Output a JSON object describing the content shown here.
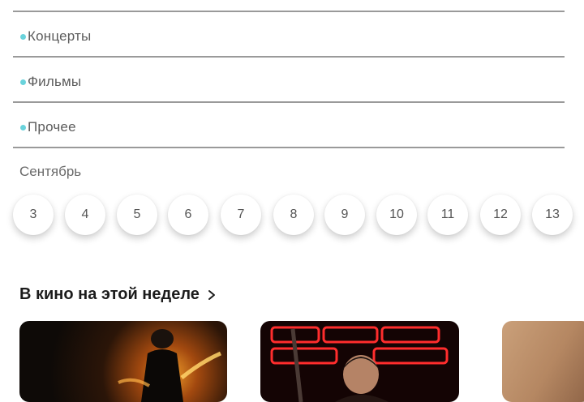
{
  "categories": [
    {
      "label": "Концерты"
    },
    {
      "label": "Фильмы"
    },
    {
      "label": "Прочее"
    }
  ],
  "calendar": {
    "month": "Сентябрь",
    "days": [
      "3",
      "4",
      "5",
      "6",
      "7",
      "8",
      "9",
      "10",
      "11",
      "12",
      "13"
    ]
  },
  "movies_section": {
    "title": "В кино на этой неделе",
    "posters": [
      "poster-1",
      "poster-2",
      "poster-3"
    ]
  },
  "colors": {
    "accent_dot": "#6ad3dc",
    "divider": "#9a9a9a"
  }
}
